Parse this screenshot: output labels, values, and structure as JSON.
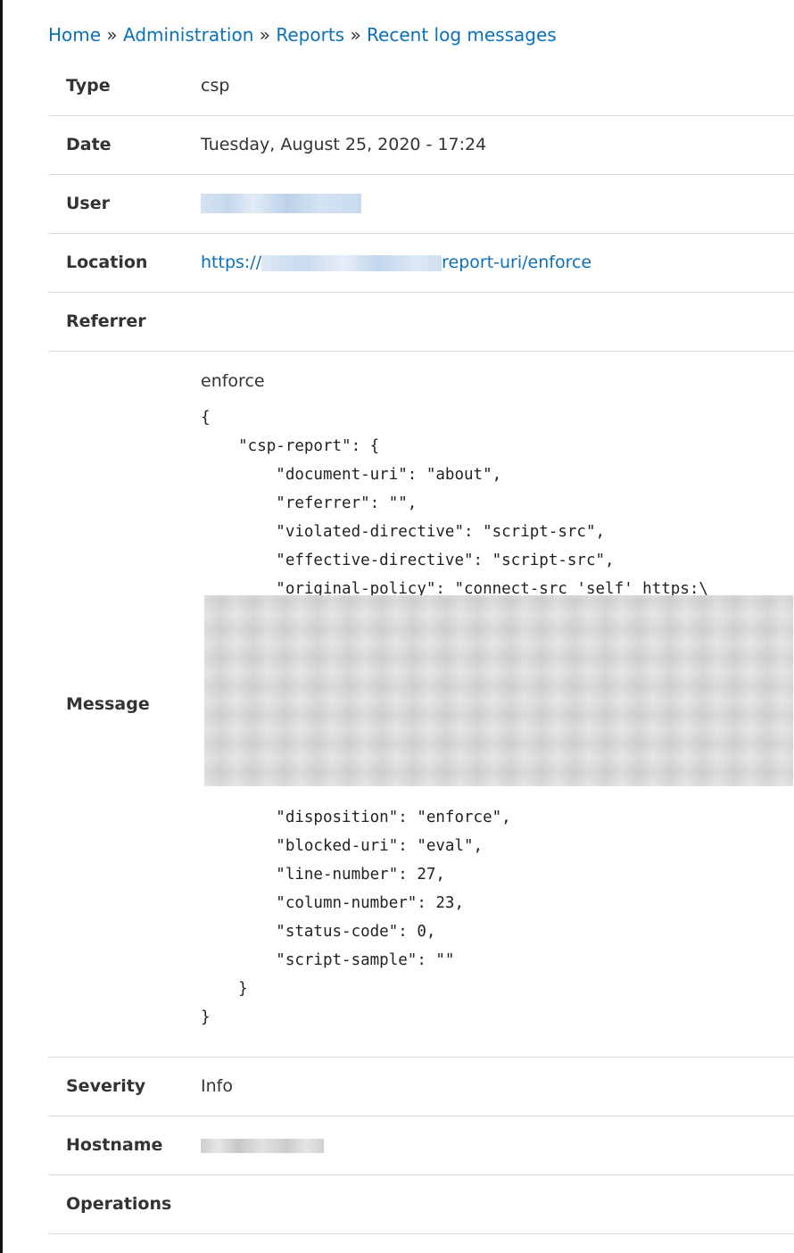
{
  "breadcrumb": {
    "home": "Home",
    "administration": "Administration",
    "reports": "Reports",
    "current": "Recent log messages",
    "separator": "»"
  },
  "details": {
    "type": {
      "label": "Type",
      "value": "csp"
    },
    "date": {
      "label": "Date",
      "value": "Tuesday, August 25, 2020 - 17:24"
    },
    "user": {
      "label": "User"
    },
    "location": {
      "label": "Location",
      "prefix": "https://",
      "suffix": "report-uri/enforce"
    },
    "referrer": {
      "label": "Referrer",
      "value": ""
    },
    "message": {
      "label": "Message",
      "title": "enforce",
      "json_top": "{\n    \"csp-report\": {\n        \"document-uri\": \"about\",\n        \"referrer\": \"\",\n        \"violated-directive\": \"script-src\",\n        \"effective-directive\": \"script-src\",\n        \"original-policy\": \"connect-src 'self' https:\\",
      "json_bottom": "        \"disposition\": \"enforce\",\n        \"blocked-uri\": \"eval\",\n        \"line-number\": 27,\n        \"column-number\": 23,\n        \"status-code\": 0,\n        \"script-sample\": \"\"\n    }\n}"
    },
    "severity": {
      "label": "Severity",
      "value": "Info"
    },
    "hostname": {
      "label": "Hostname"
    },
    "operations": {
      "label": "Operations",
      "value": ""
    }
  },
  "colors": {
    "link": "#0a70b8",
    "text": "#333333",
    "border": "#d8d8d8"
  }
}
